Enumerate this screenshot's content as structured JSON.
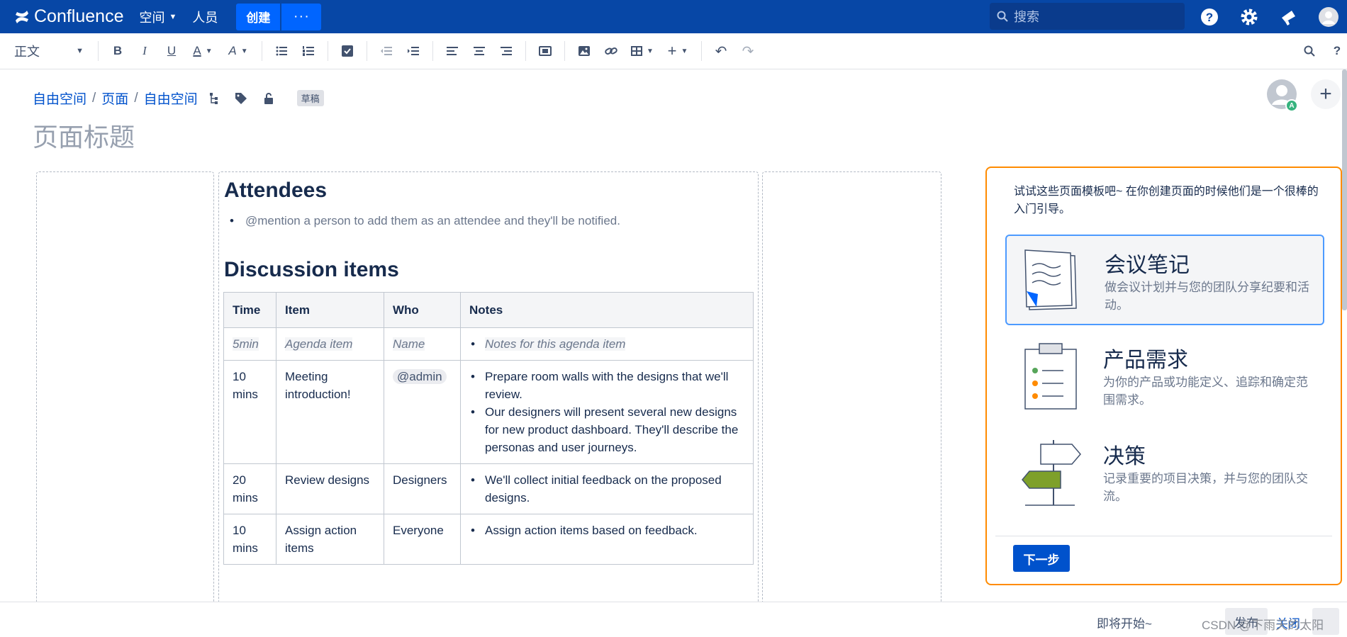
{
  "nav": {
    "logo": "Confluence",
    "spaces": "空间",
    "people": "人员",
    "create": "创建",
    "more": "···",
    "search_placeholder": "搜索"
  },
  "toolbar": {
    "paragraph_style": "正文"
  },
  "breadcrumb": {
    "items": [
      "自由空间",
      "页面",
      "自由空间"
    ],
    "sep": "/",
    "draft": "草稿"
  },
  "avatar_badge": "A",
  "page_title": "页面标题",
  "content": {
    "attendees_heading": "Attendees",
    "attendees_hint": "@mention a person to add them as an attendee and they'll be notified.",
    "discussion_heading": "Discussion items",
    "table": {
      "headers": [
        "Time",
        "Item",
        "Who",
        "Notes"
      ],
      "rows": [
        {
          "time": "5min",
          "item": "Agenda item",
          "who": "Name",
          "notes": [
            "Notes for this agenda item"
          ]
        },
        {
          "time": "10 mins",
          "item": "Meeting introduction!",
          "who": "@admin",
          "notes": [
            "Prepare room walls with the designs that we'll review.",
            "Our designers will present several new designs for new product dashboard. They'll describe the personas and user journeys."
          ]
        },
        {
          "time": "20 mins",
          "item": "Review designs",
          "who": "Designers",
          "notes": [
            "We'll collect initial feedback on the proposed designs."
          ]
        },
        {
          "time": "10 mins",
          "item": "Assign action items",
          "who": "Everyone",
          "notes": [
            "Assign action items based on feedback."
          ]
        }
      ]
    }
  },
  "templates": {
    "intro": "试试这些页面模板吧~ 在你创建页面的时候他们是一个很棒的入门引导。",
    "cards": [
      {
        "title": "会议笔记",
        "desc": "做会议计划并与您的团队分享纪要和活动。"
      },
      {
        "title": "产品需求",
        "desc": "为你的产品或功能定义、追踪和确定范围需求。"
      },
      {
        "title": "决策",
        "desc": "记录重要的项目决策，并与您的团队交流。"
      }
    ],
    "next": "下一步"
  },
  "footer": {
    "coming_soon": "即将开始~",
    "publish": "发布",
    "close": "关闭"
  },
  "watermark": "CSDN @下雨天的太阳"
}
